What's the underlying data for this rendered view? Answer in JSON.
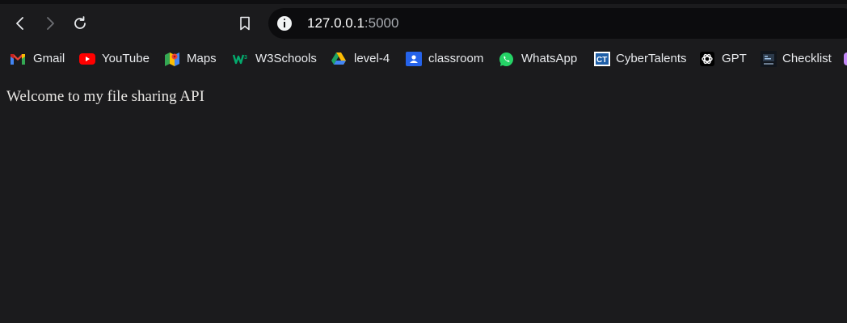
{
  "browser": {
    "address_bar": {
      "url_host": "127.0.0.1",
      "url_port": ":5000",
      "info_icon": "info-icon"
    },
    "nav": {
      "back_icon": "back-arrow-icon",
      "forward_icon": "forward-arrow-icon",
      "reload_icon": "reload-icon",
      "bookmark_icon": "bookmark-icon"
    },
    "bookmarks": [
      {
        "label": "Gmail",
        "icon": "gmail-icon"
      },
      {
        "label": "YouTube",
        "icon": "youtube-icon"
      },
      {
        "label": "Maps",
        "icon": "maps-icon"
      },
      {
        "label": "W3Schools",
        "icon": "w3schools-icon"
      },
      {
        "label": "level-4",
        "icon": "google-drive-icon"
      },
      {
        "label": "classroom",
        "icon": "classroom-icon"
      },
      {
        "label": "WhatsApp",
        "icon": "whatsapp-icon"
      },
      {
        "label": "CyberTalents",
        "icon": "cybertalents-icon"
      },
      {
        "label": "GPT",
        "icon": "openai-icon"
      },
      {
        "label": "Checklist",
        "icon": "checklist-icon"
      }
    ]
  },
  "page": {
    "welcome_text": "Welcome to my file sharing API"
  },
  "colors": {
    "background": "#1b1b1d",
    "address_bar_bg": "#0c0c0e",
    "text": "#e8eaed",
    "youtube_red": "#ff0000",
    "whatsapp_green": "#25d366",
    "w3schools_green": "#04aa6d",
    "classroom_blue": "#1e8e3e"
  }
}
